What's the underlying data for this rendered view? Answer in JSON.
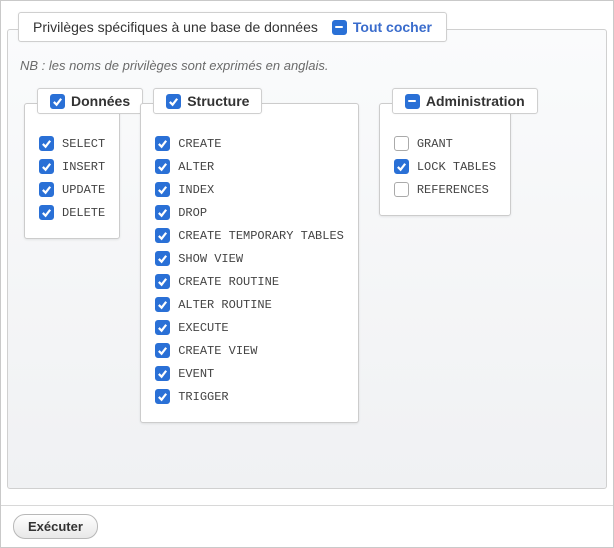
{
  "legend": {
    "title": "Privilèges spécifiques à une base de données",
    "check_all_label": "Tout cocher",
    "check_all_state": "indet"
  },
  "note": "NB : les noms de privilèges sont exprimés en anglais.",
  "groups": [
    {
      "title": "Données",
      "header_state": "checked",
      "items": [
        {
          "label": "SELECT",
          "state": "checked"
        },
        {
          "label": "INSERT",
          "state": "checked"
        },
        {
          "label": "UPDATE",
          "state": "checked"
        },
        {
          "label": "DELETE",
          "state": "checked"
        }
      ]
    },
    {
      "title": "Structure",
      "header_state": "checked",
      "items": [
        {
          "label": "CREATE",
          "state": "checked"
        },
        {
          "label": "ALTER",
          "state": "checked"
        },
        {
          "label": "INDEX",
          "state": "checked"
        },
        {
          "label": "DROP",
          "state": "checked"
        },
        {
          "label": "CREATE TEMPORARY TABLES",
          "state": "checked"
        },
        {
          "label": "SHOW VIEW",
          "state": "checked"
        },
        {
          "label": "CREATE ROUTINE",
          "state": "checked"
        },
        {
          "label": "ALTER ROUTINE",
          "state": "checked"
        },
        {
          "label": "EXECUTE",
          "state": "checked"
        },
        {
          "label": "CREATE VIEW",
          "state": "checked"
        },
        {
          "label": "EVENT",
          "state": "checked"
        },
        {
          "label": "TRIGGER",
          "state": "checked"
        }
      ]
    },
    {
      "title": "Administration",
      "header_state": "indet",
      "items": [
        {
          "label": "GRANT",
          "state": "unchecked"
        },
        {
          "label": "LOCK TABLES",
          "state": "checked"
        },
        {
          "label": "REFERENCES",
          "state": "unchecked"
        }
      ]
    }
  ],
  "execute_label": "Exécuter"
}
